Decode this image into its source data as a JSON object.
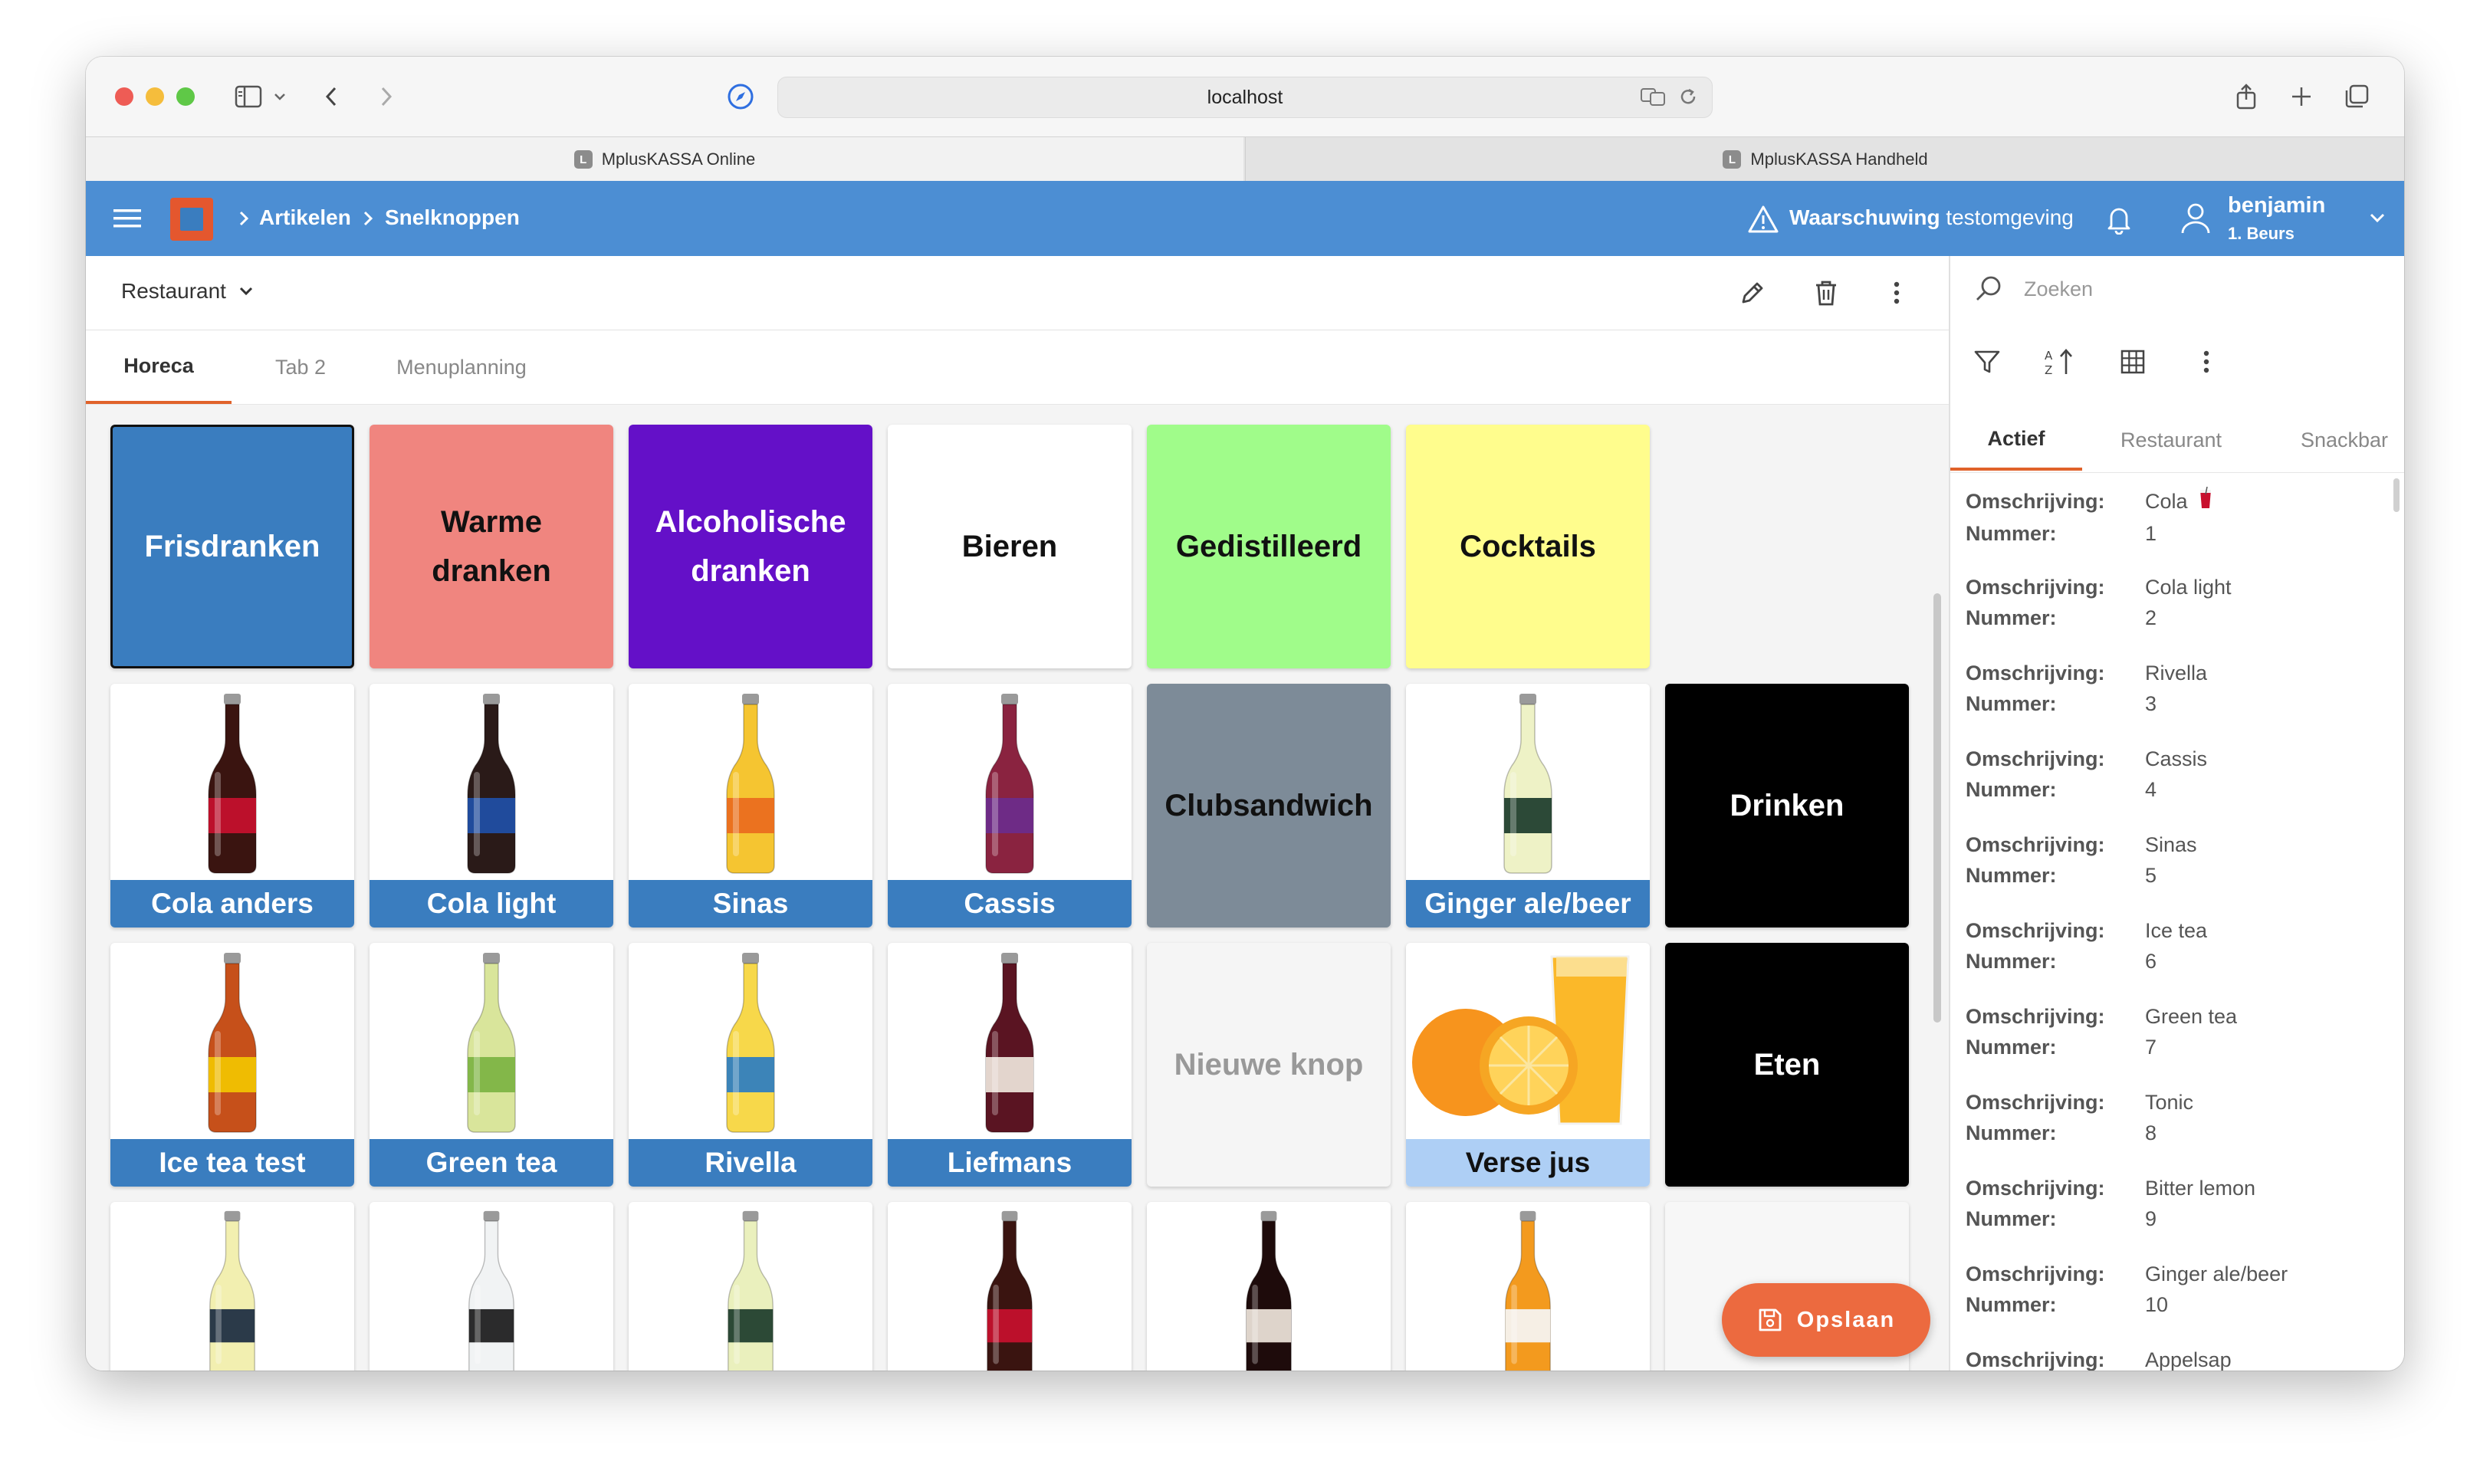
{
  "browser": {
    "url": "localhost",
    "tabs": [
      {
        "label": "MplusKASSA Online",
        "favicon": "L"
      },
      {
        "label": "MplusKASSA Handheld",
        "favicon": "L"
      }
    ]
  },
  "header": {
    "breadcrumb": [
      "Artikelen",
      "Snelknoppen"
    ],
    "warning_bold": "Waarschuwing",
    "warning_rest": "testomgeving",
    "user_name": "benjamin",
    "user_sub": "1. Beurs"
  },
  "toolbar": {
    "dropdown_value": "Restaurant"
  },
  "tabs": [
    "Horeca",
    "Tab 2",
    "Menuplanning"
  ],
  "tiles": [
    {
      "label": "Frisdranken",
      "bg": "#3a7dbf",
      "fg": "#ffffff",
      "kind": "text"
    },
    {
      "label": "Warme dranken",
      "bg": "#f0857f",
      "fg": "#111111",
      "kind": "text"
    },
    {
      "label": "Alcoholische dranken",
      "bg": "#6410c8",
      "fg": "#ffffff",
      "kind": "text"
    },
    {
      "label": "Bieren",
      "bg": "#ffffff",
      "fg": "#111111",
      "kind": "text"
    },
    {
      "label": "Gedistilleerd",
      "bg": "#a0fc8a",
      "fg": "#111111",
      "kind": "text"
    },
    {
      "label": "Cocktails",
      "bg": "#fffd8d",
      "fg": "#111111",
      "kind": "text"
    },
    {
      "label": "Cola anders",
      "kind": "bottle",
      "liquid": "#3a1410",
      "label_color": "#c8102e"
    },
    {
      "label": "Cola light",
      "kind": "bottle",
      "liquid": "#2a1a18",
      "label_color": "#1f4fa8"
    },
    {
      "label": "Sinas",
      "kind": "bottle",
      "liquid": "#f5c531",
      "label_color": "#e96a1d"
    },
    {
      "label": "Cassis",
      "kind": "bottle",
      "liquid": "#8a2340",
      "label_color": "#6b2d8c"
    },
    {
      "label": "Clubsandwich",
      "bg": "#7d8b98",
      "fg": "#111111",
      "kind": "text"
    },
    {
      "label": "Ginger ale/beer",
      "kind": "bottle",
      "liquid": "#eef2c6",
      "label_color": "#1b3b2a"
    },
    {
      "label": "Drinken",
      "bg": "#000000",
      "fg": "#ffffff",
      "kind": "text"
    },
    {
      "label": "Ice tea test",
      "kind": "bottle",
      "liquid": "#c6501a",
      "label_color": "#f2c500"
    },
    {
      "label": "Green tea",
      "kind": "bottle",
      "liquid": "#d9e59b",
      "label_color": "#7cb342"
    },
    {
      "label": "Rivella",
      "kind": "bottle",
      "liquid": "#f7d84a",
      "label_color": "#2b7dc1"
    },
    {
      "label": "Liefmans",
      "kind": "bottle",
      "liquid": "#5a1422",
      "label_color": "#efe6dc"
    },
    {
      "label": "Nieuwe knop",
      "bg": "#f5f5f5",
      "fg": "#999999",
      "kind": "text"
    },
    {
      "label": "Verse jus",
      "kind": "photo"
    },
    {
      "label": "Eten",
      "bg": "#000000",
      "fg": "#ffffff",
      "kind": "text"
    },
    {
      "label": "",
      "kind": "bottle",
      "liquid": "#f2efb0",
      "label_color": "#1a2a40"
    },
    {
      "label": "",
      "kind": "bottle",
      "liquid": "#f1f3f4",
      "label_color": "#1a1a1a"
    },
    {
      "label": "",
      "kind": "bottle",
      "liquid": "#eaf0bd",
      "label_color": "#1b3b2a"
    },
    {
      "label": "",
      "kind": "bottle",
      "liquid": "#3a1410",
      "label_color": "#c8102e"
    },
    {
      "label": "",
      "kind": "bottle",
      "liquid": "#1e0b0b",
      "label_color": "#efe6dc"
    },
    {
      "label": "",
      "kind": "bottle",
      "liquid": "#f39a1e",
      "label_color": "#f6f6f6"
    },
    {
      "label": "hoofdgroep",
      "bg": "#f7f7f7",
      "fg": "#a6a6a6",
      "kind": "text"
    }
  ],
  "side": {
    "search_placeholder": "Zoeken",
    "tabs": [
      "Actief",
      "Restaurant",
      "Snackbar"
    ],
    "key_desc": "Omschrijving:",
    "key_num": "Nummer:",
    "items": [
      {
        "desc": "Cola",
        "num": "1"
      },
      {
        "desc": "Cola light",
        "num": "2"
      },
      {
        "desc": "Rivella",
        "num": "3"
      },
      {
        "desc": "Cassis",
        "num": "4"
      },
      {
        "desc": "Sinas",
        "num": "5"
      },
      {
        "desc": "Ice tea",
        "num": "6"
      },
      {
        "desc": "Green tea",
        "num": "7"
      },
      {
        "desc": "Tonic",
        "num": "8"
      },
      {
        "desc": "Bitter lemon",
        "num": "9"
      },
      {
        "desc": "Ginger ale/beer",
        "num": "10"
      },
      {
        "desc": "Appelsap",
        "num": ""
      }
    ]
  },
  "save_label": "Opslaan"
}
